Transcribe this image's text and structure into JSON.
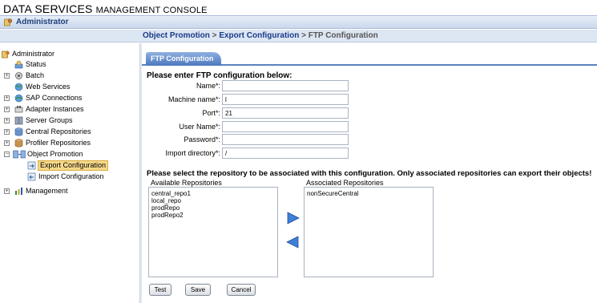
{
  "app": {
    "title_main": "DATA SERVICES ",
    "title_small": "MANAGEMENT CONSOLE"
  },
  "admin_bar": {
    "label": "Administrator"
  },
  "breadcrumb": {
    "part1": "Object Promotion",
    "sep1": " > ",
    "part2": "Export Configuration",
    "sep2": " > ",
    "current": "FTP Configuration"
  },
  "sidebar": {
    "items": [
      {
        "label": "Administrator"
      },
      {
        "label": "Status"
      },
      {
        "label": "Batch"
      },
      {
        "label": "Web Services"
      },
      {
        "label": "SAP Connections"
      },
      {
        "label": "Adapter Instances"
      },
      {
        "label": "Server Groups"
      },
      {
        "label": "Central Repositories"
      },
      {
        "label": "Profiler Repositories"
      },
      {
        "label": "Object Promotion"
      },
      {
        "label": "Export Configuration"
      },
      {
        "label": "Import Configuration"
      },
      {
        "label": "Management"
      }
    ],
    "expand_plus": "+",
    "expand_minus": "−"
  },
  "tab": {
    "label": "FTP Configuration"
  },
  "form": {
    "heading": "Please enter FTP configuration below:",
    "fields": [
      {
        "label": "Name*:",
        "value": ""
      },
      {
        "label": "Machine name*:",
        "value": "l"
      },
      {
        "label": "Port*:",
        "value": "21"
      },
      {
        "label": "User Name*:",
        "value": ""
      },
      {
        "label": "Password*:",
        "value": ""
      },
      {
        "label": "Import directory*:",
        "value": "/"
      }
    ]
  },
  "repos": {
    "heading": "Please select the repository to be associated with this configuration. Only associated repositories can export their objects!",
    "available_label": "Available Repositories",
    "associated_label": "Associated Repositories",
    "available": [
      "central_repo1",
      "local_repo",
      "prodRepo",
      "prodRepo2"
    ],
    "associated": [
      "nonSecureCentral"
    ]
  },
  "buttons": {
    "test": "Test",
    "save": "Save",
    "cancel": "Cancel"
  },
  "colors": {
    "accent": "#4d78be",
    "selection": "#f6d88a",
    "arrow": "#3f7fd6"
  }
}
